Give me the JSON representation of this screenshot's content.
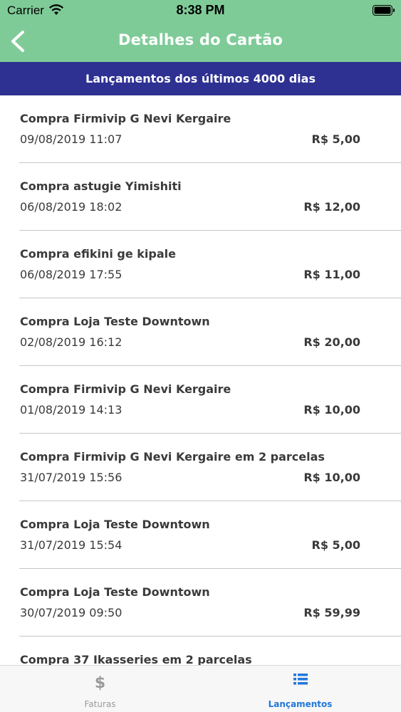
{
  "status_bar": {
    "carrier": "Carrier",
    "time": "8:38 PM"
  },
  "header": {
    "title": "Detalhes do Cartão",
    "back_icon": "chevron-left-icon"
  },
  "banner": {
    "text": "Lançamentos dos últimos 4000 dias"
  },
  "transactions": [
    {
      "description": "Compra Firmivip G Nevi Kergaire",
      "date": "09/08/2019 11:07",
      "amount": "R$ 5,00"
    },
    {
      "description": "Compra astugie Yimishiti",
      "date": "06/08/2019 18:02",
      "amount": "R$ 12,00"
    },
    {
      "description": "Compra efikini ge kipale",
      "date": "06/08/2019 17:55",
      "amount": "R$ 11,00"
    },
    {
      "description": "Compra Loja Teste Downtown",
      "date": "02/08/2019 16:12",
      "amount": "R$ 20,00"
    },
    {
      "description": "Compra Firmivip G Nevi Kergaire",
      "date": "01/08/2019 14:13",
      "amount": "R$ 10,00"
    },
    {
      "description": "Compra Firmivip G Nevi Kergaire em 2 parcelas",
      "date": "31/07/2019 15:56",
      "amount": "R$ 10,00"
    },
    {
      "description": "Compra Loja Teste Downtown",
      "date": "31/07/2019 15:54",
      "amount": "R$ 5,00"
    },
    {
      "description": "Compra Loja Teste Downtown",
      "date": "30/07/2019 09:50",
      "amount": "R$ 59,99"
    },
    {
      "description": "Compra 37 Ikasseries em 2 parcelas",
      "date": "",
      "amount": ""
    }
  ],
  "tabs": [
    {
      "label": "Faturas",
      "icon": "dollar-icon",
      "icon_glyph": "$",
      "active": false
    },
    {
      "label": "Lançamentos",
      "icon": "list-icon",
      "active": true
    }
  ],
  "colors": {
    "header_green": "#7fcb98",
    "banner_blue": "#2e3192",
    "active_tab": "#2277d8"
  }
}
